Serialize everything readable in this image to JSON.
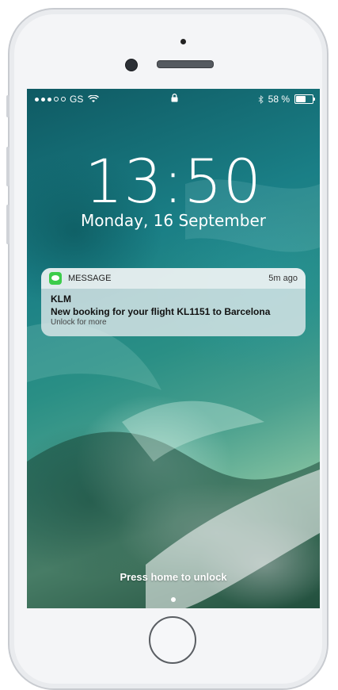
{
  "status_bar": {
    "carrier": "GS",
    "battery_percent": "58 %",
    "battery_level": 0.58,
    "icons": [
      "signal-dots-icon",
      "wifi-icon",
      "lock-icon",
      "bluetooth-icon",
      "battery-icon"
    ]
  },
  "lock_screen": {
    "time": "13:50",
    "date": "Monday, 16 September",
    "unlock_hint": "Press home to unlock"
  },
  "notification": {
    "app_name": "MESSAGE",
    "age": "5m ago",
    "sender": "KLM",
    "message": "New booking for your flight KL1151 to Barcelona",
    "subtitle": "Unlock for more",
    "app_icon": "messages-icon",
    "app_color": "#3ccc4a"
  }
}
